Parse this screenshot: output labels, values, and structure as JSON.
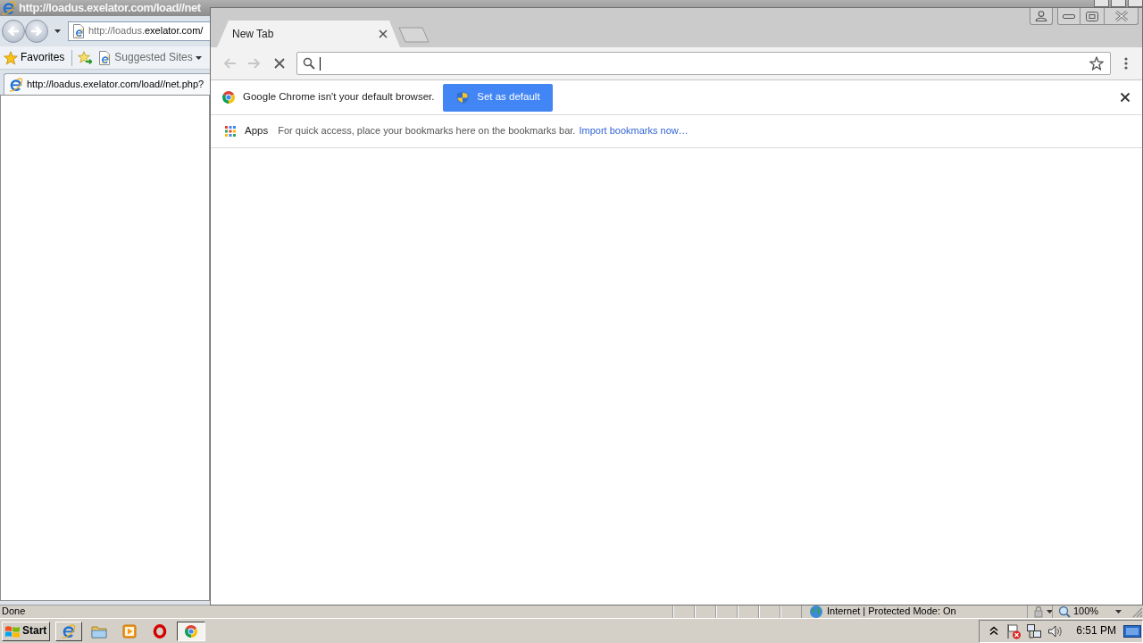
{
  "ie_window": {
    "title": "http://loadus.exelator.com/load//net",
    "address_bar": {
      "scheme_host": "http://loadus.",
      "domain": "exelator.com/"
    },
    "favorites_bar": {
      "favorites": "Favorites",
      "suggested_sites": "Suggested Sites"
    },
    "tab": {
      "title": "http://loadus.exelator.com/load//net.php?"
    },
    "status_bar": {
      "status": "Done",
      "zone": "Internet | Protected Mode: On",
      "zoom": "100%"
    }
  },
  "chrome_window": {
    "tabs": [
      {
        "title": "New Tab",
        "selected": true
      }
    ],
    "toolbar": {
      "back_disabled": true,
      "forward_disabled": true,
      "loading": true,
      "omnibox_focused": true,
      "bookmarked": false
    },
    "infobar": {
      "message": "Google Chrome isn't your default browser.",
      "button": "Set as default"
    },
    "bookmarks_bar": {
      "apps": "Apps",
      "hint": "For quick access, place your bookmarks here on the bookmarks bar.",
      "link": "Import bookmarks now…"
    }
  },
  "taskbar": {
    "start": "Start",
    "apps": [
      {
        "kind": "ie",
        "open": true,
        "selected": false
      },
      {
        "kind": "explorer",
        "open": false,
        "selected": false
      },
      {
        "kind": "media",
        "open": false,
        "selected": false
      },
      {
        "kind": "opera",
        "open": false,
        "selected": false
      },
      {
        "kind": "chrome",
        "open": true,
        "selected": true
      }
    ],
    "clock": "6:51 PM"
  }
}
